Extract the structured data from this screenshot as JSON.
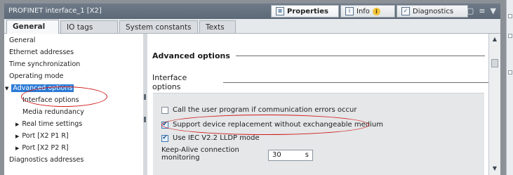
{
  "window": {
    "title": "PROFINET interface_1 [X2]",
    "tabs": [
      {
        "label": "Properties",
        "icon": "properties-icon",
        "active": true
      },
      {
        "label": "Info",
        "icon": "info-tab-icon",
        "active": false
      },
      {
        "label": "Diagnostics",
        "icon": "diagnostics-icon",
        "active": false
      }
    ]
  },
  "property_tabs": [
    {
      "label": "General",
      "active": true
    },
    {
      "label": "IO tags",
      "active": false
    },
    {
      "label": "System constants",
      "active": false
    },
    {
      "label": "Texts",
      "active": false
    }
  ],
  "nav": {
    "items": [
      {
        "label": "General"
      },
      {
        "label": "Ethernet addresses"
      },
      {
        "label": "Time synchronization"
      },
      {
        "label": "Operating mode"
      },
      {
        "label": "Advanced options",
        "selected": true,
        "expanded": true
      },
      {
        "label": "Interface options"
      },
      {
        "label": "Media redundancy"
      },
      {
        "label": "Real time settings"
      },
      {
        "label": "Port [X2 P1 R]"
      },
      {
        "label": "Port [X2 P2 R]"
      },
      {
        "label": "Diagnostics addresses"
      }
    ]
  },
  "main": {
    "section_title": "Advanced options",
    "subsection_title": "Interface options",
    "options": [
      {
        "label": "Call the user program if communication errors occur",
        "checked": false
      },
      {
        "label": "Support device replacement without exchangeable medium",
        "checked": true
      },
      {
        "label": "Use IEC V2.2 LLDP mode",
        "checked": true
      }
    ],
    "keepalive": {
      "label_line1": "Keep-Alive connection",
      "label_line2": "monitoring",
      "value": "30",
      "unit": "s"
    }
  },
  "colors": {
    "selection": "#2b7bd6",
    "highlight_oval": "#d11a1a",
    "titlebar": "#5d6977"
  }
}
